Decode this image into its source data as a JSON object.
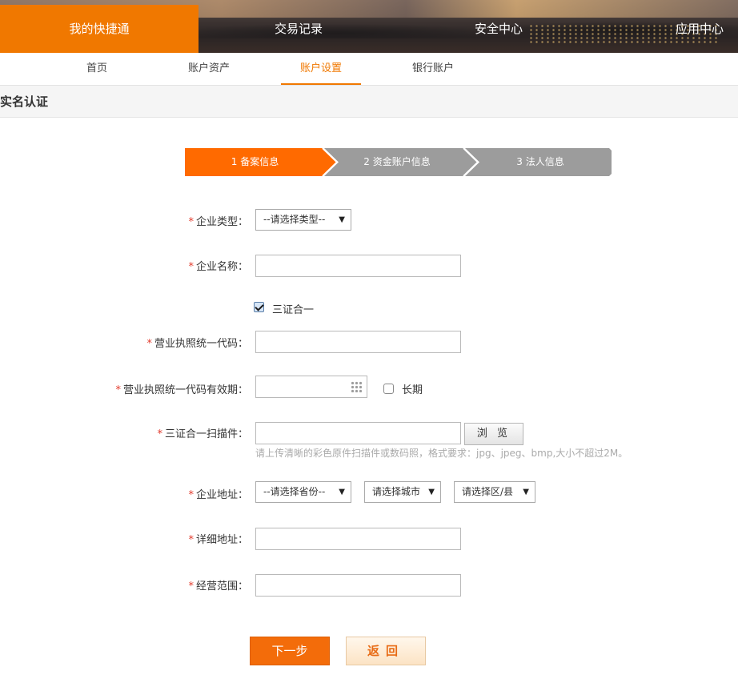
{
  "top_nav": {
    "items": [
      {
        "label": "我的快捷通",
        "active": true
      },
      {
        "label": "交易记录",
        "active": false
      },
      {
        "label": "安全中心",
        "active": false
      },
      {
        "label": "应用中心",
        "active": false
      }
    ]
  },
  "sub_nav": {
    "items": [
      {
        "label": "首页",
        "active": false
      },
      {
        "label": "账户资产",
        "active": false
      },
      {
        "label": "账户设置",
        "active": true
      },
      {
        "label": "银行账户",
        "active": false
      }
    ]
  },
  "page": {
    "title": "实名认证"
  },
  "steps": [
    {
      "label": "1 备案信息",
      "active": true
    },
    {
      "label": "2 资金账户信息",
      "active": false
    },
    {
      "label": "3 法人信息",
      "active": false
    }
  ],
  "form": {
    "required_mark": "*",
    "company_type": {
      "label": "企业类型：",
      "selected": "--请选择类型--"
    },
    "company_name": {
      "label": "企业名称：",
      "value": ""
    },
    "three_in_one": {
      "label": "三证合一",
      "checked": true
    },
    "license_code": {
      "label": "营业执照统一代码：",
      "value": ""
    },
    "license_valid": {
      "label": "营业执照统一代码有效期：",
      "value": "",
      "long_term_label": "长期",
      "long_term_checked": false
    },
    "scan": {
      "label": "三证合一扫描件：",
      "value": "",
      "browse_label": "浏 览",
      "hint": "请上传清晰的彩色原件扫描件或数码照，格式要求：jpg、jpeg、bmp,大小不超过2M。"
    },
    "address": {
      "label": "企业地址：",
      "province": "--请选择省份--",
      "city": "请选择城市",
      "district": "请选择区/县"
    },
    "detail_address": {
      "label": "详细地址：",
      "value": ""
    },
    "business_scope": {
      "label": "经营范围：",
      "value": ""
    }
  },
  "actions": {
    "next_label": "下一步",
    "back_label": "返回"
  },
  "colors": {
    "accent": "#f07800",
    "step_active": "#ff6a00",
    "step_inactive": "#9c9c9c",
    "required": "#e23b2c"
  }
}
